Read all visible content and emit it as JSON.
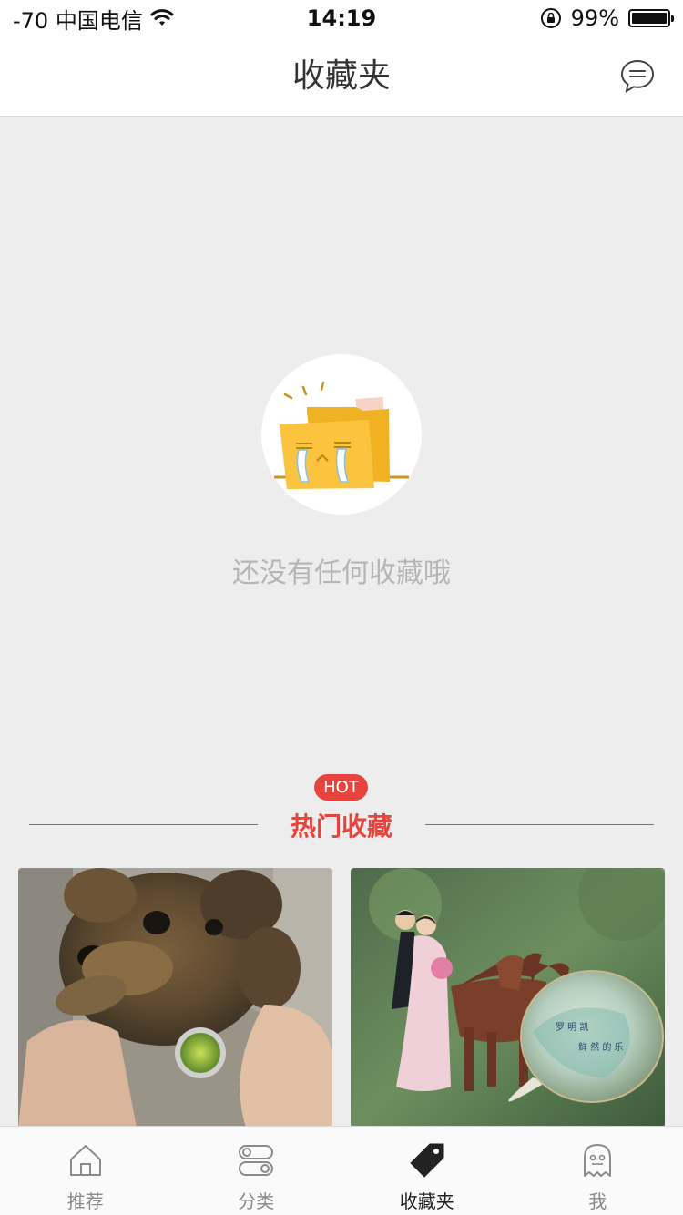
{
  "status_bar": {
    "carrier": "-70 中国电信",
    "time": "14:19",
    "battery": "99%",
    "battery_level": 0.99
  },
  "nav": {
    "title": "收藏夹",
    "message_icon": "chat-bubble-icon"
  },
  "empty_state": {
    "icon": "crying-folder-icon",
    "message": "还没有任何收藏哦"
  },
  "hot_section": {
    "badge": "HOT",
    "title": "热门收藏",
    "accent": "#e8443e",
    "cards": [
      {
        "subject": "yorkshire-terrier-photo"
      },
      {
        "subject": "wedding-couple-horse-figurine-photo"
      }
    ]
  },
  "tab_bar": {
    "tabs": [
      {
        "label": "推荐",
        "icon": "home-icon",
        "active": false
      },
      {
        "label": "分类",
        "icon": "toggle-icon",
        "active": false
      },
      {
        "label": "收藏夹",
        "icon": "tag-icon",
        "active": true
      },
      {
        "label": "我",
        "icon": "ghost-icon",
        "active": false
      }
    ]
  }
}
